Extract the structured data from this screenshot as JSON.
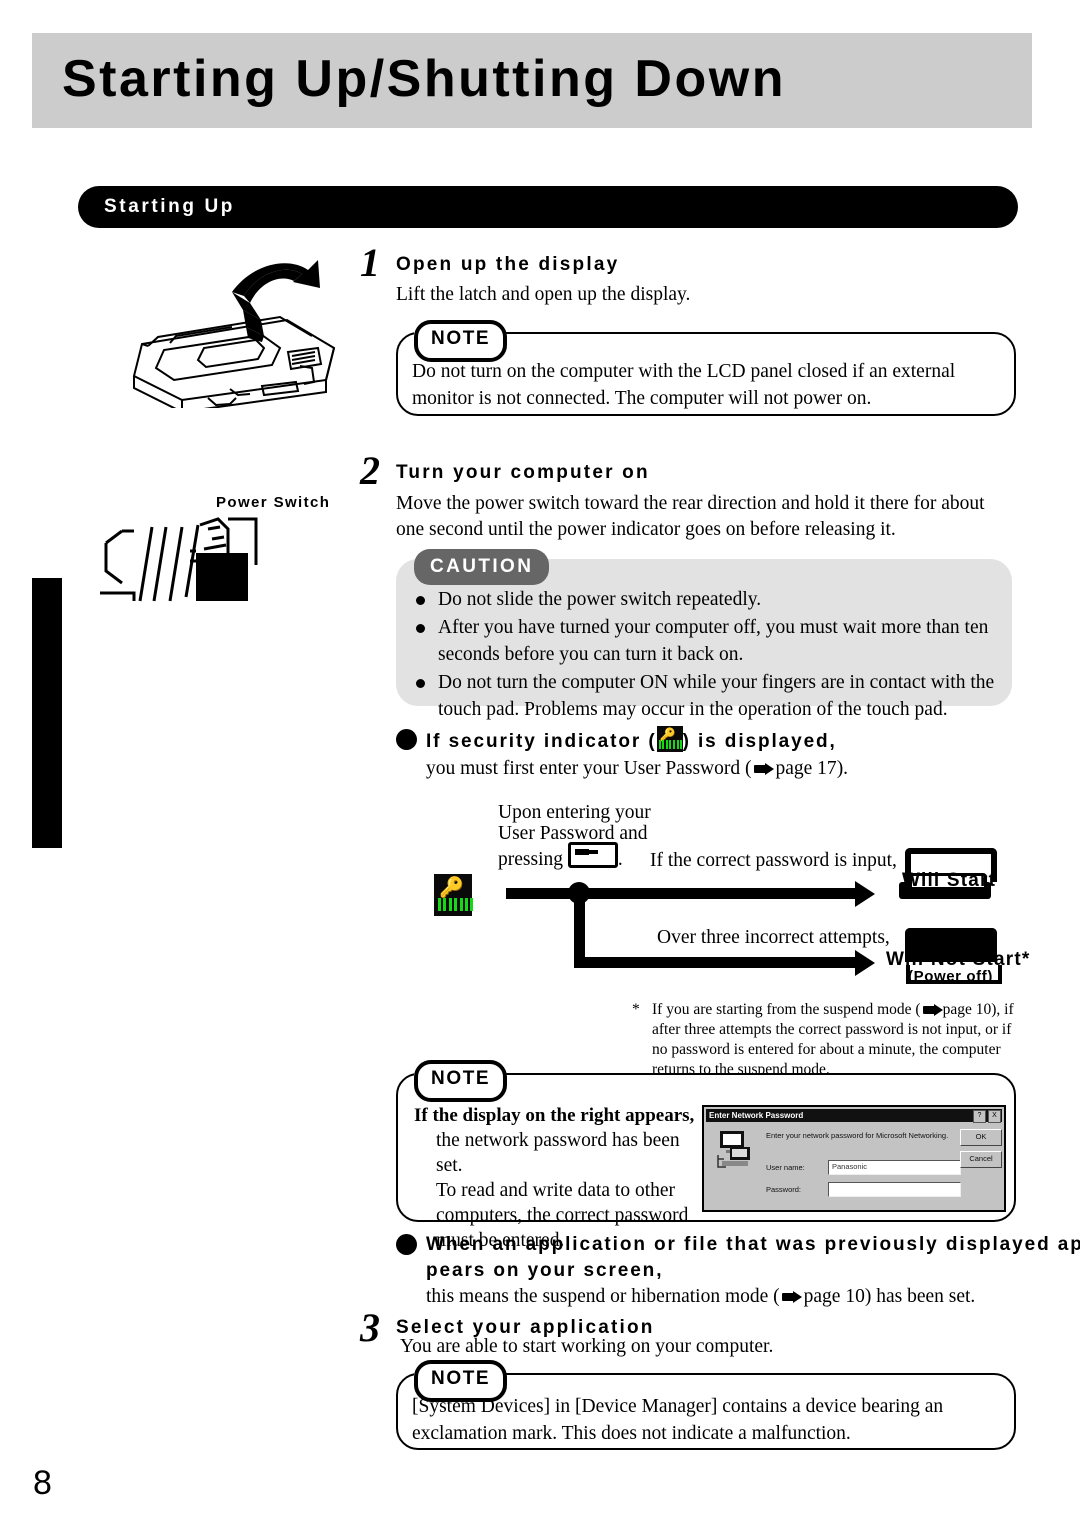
{
  "header": {
    "title": "Starting Up/Shutting Down"
  },
  "section": {
    "label": "Starting Up"
  },
  "page_number": "8",
  "illustrations": {
    "laptop_open_alt": "laptop-opening-lid-diagram",
    "power_switch_label": "Power Switch"
  },
  "steps": [
    {
      "number": "1",
      "heading": "Open up the display",
      "body": "Lift the latch and open up the display.",
      "note": {
        "tag": "NOTE",
        "text": "Do not turn on the computer with the LCD panel closed if an external monitor is not connected. The computer will not power on."
      }
    },
    {
      "number": "2",
      "heading": "Turn your computer on",
      "body": "Move the power switch toward the rear direction and hold it there for about one second until the power indicator goes on before releasing it.",
      "caution": {
        "tag": "CAUTION",
        "items": [
          "Do not slide the power switch repeatedly.",
          "After you have turned your computer off, you must wait more than ten seconds before you can turn it back on.",
          "Do not turn the computer ON while your fingers are in contact with the touch pad.  Problems may occur in the operation of the touch pad."
        ]
      }
    },
    {
      "number": "3",
      "heading": "Select your application",
      "body": "You are able to start working on your computer.",
      "note": {
        "tag": "NOTE",
        "text": "[System Devices] in [Device Manager] contains a device bearing an exclamation mark. This does not indicate a malfunction."
      }
    }
  ],
  "security_bullet": {
    "heading_part1": "If security indicator (",
    "heading_part2": ") is displayed,",
    "body_before": "you must first enter your User Password (",
    "body_page_ref": "page 17",
    "body_after": ")."
  },
  "flow": {
    "intro_line1": "Upon entering your",
    "intro_line2": "User Password and",
    "intro_line3_before": "pressing",
    "intro_line3_after": ".",
    "branch_correct_label": "If the correct password is input,",
    "branch_correct_result": "Will Start",
    "branch_fail_label": "Over three incorrect attempts,",
    "branch_fail_result": "Will Not Start*",
    "branch_fail_sub": "(Power off)"
  },
  "footnote": {
    "marker": "*",
    "text_before": "If you are starting from the suspend mode (",
    "page_ref": "page 10",
    "text_after": "), if after three attempts the correct password is not input, or if no password is entered for about a minute, the computer returns to the suspend mode."
  },
  "network_note": {
    "tag": "NOTE",
    "bold_line": "If the display on the right appears,",
    "body_lines": [
      "the network password has been set.",
      "To read and write data to other",
      "computers, the correct password",
      "must be entered."
    ],
    "dialog": {
      "title": "Enter Network Password",
      "help_button": "?",
      "close_button": "X",
      "message": "Enter your network password for Microsoft Networking.",
      "username_label": "User name:",
      "username_value": "Panasonic",
      "password_label": "Password:",
      "password_value": "",
      "ok_button": "OK",
      "cancel_button": "Cancel"
    }
  },
  "app_bullet": {
    "heading_line1": "When an application or file that was previously displayed ap-",
    "heading_line2": "pears on your screen,",
    "body_before": "this means the suspend or hibernation mode (",
    "body_page_ref": "page 10",
    "body_after": ") has been set."
  }
}
